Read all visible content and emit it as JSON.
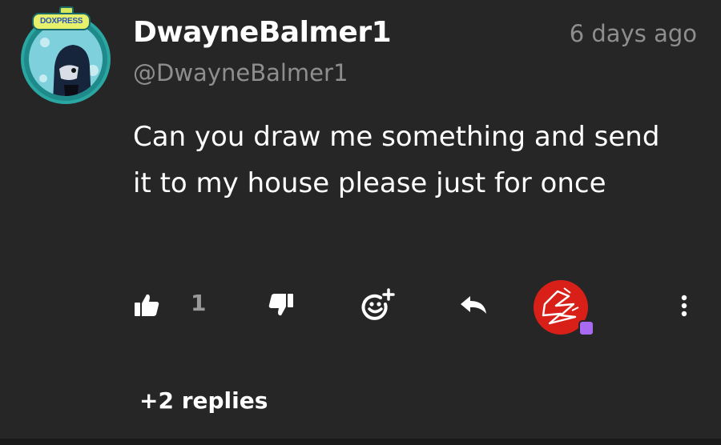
{
  "comment": {
    "author": {
      "display_name": "DwayneBalmer1",
      "handle": "@DwayneBalmer1",
      "avatar_badge_text": "DOXPRESS"
    },
    "timestamp": "6 days ago",
    "body": "Can you draw me something and send it to my house please just for once",
    "likes": "1",
    "replies_label": "+2 replies"
  },
  "actions": {
    "like_icon": "thumbs-up-icon",
    "dislike_icon": "thumbs-down-icon",
    "react_icon": "add-reaction-icon",
    "reply_icon": "reply-arrow-icon",
    "more_icon": "vertical-dots-icon"
  },
  "colors": {
    "background": "#262626",
    "text_primary": "#ffffff",
    "text_secondary": "#8e8e8e",
    "creator_avatar": "#d82018",
    "heart_badge": "#a86af0"
  }
}
